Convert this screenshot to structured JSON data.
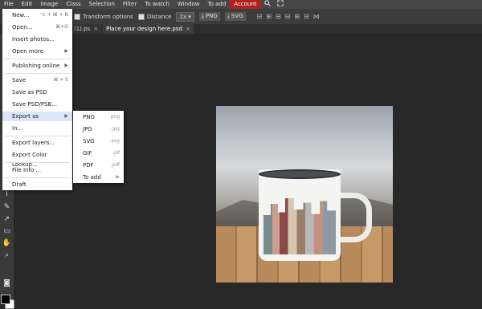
{
  "menubar": {
    "items": [
      "File",
      "Edit",
      "Image",
      "Class",
      "Selection",
      "Filter",
      "To watch",
      "Window",
      "To add",
      "Account"
    ],
    "icons": [
      "search-icon",
      "fullscreen-icon"
    ]
  },
  "optbar": {
    "transform_label": "Transform options",
    "distance_label": "Distance",
    "scale_value": "1x",
    "png_label": "PNG",
    "svg_label": "SVG"
  },
  "tabs": [
    {
      "label": "(1).ps",
      "close": "×"
    },
    {
      "label": "Place your design here.psd",
      "close": "×"
    }
  ],
  "file_menu": {
    "items": [
      {
        "label": "New...",
        "shortcut": "⌥ + ⌘ + N"
      },
      {
        "label": "Open...",
        "shortcut": "⌘+O"
      },
      {
        "label": "Insert photos...",
        "shortcut": ""
      },
      {
        "label": "Open more",
        "shortcut": "▶"
      },
      {
        "label": "Publishing online",
        "shortcut": "▶"
      },
      {
        "label": "Save",
        "shortcut": "⌘ + S"
      },
      {
        "label": "Save as PSD",
        "shortcut": ""
      },
      {
        "label": "Save PSD/PSB...",
        "shortcut": ""
      },
      {
        "label": "Export as",
        "shortcut": "▶"
      },
      {
        "label": "In...",
        "shortcut": ""
      },
      {
        "label": "Export layers...",
        "shortcut": ""
      },
      {
        "label": "Export Color Lookup...",
        "shortcut": ""
      },
      {
        "label": "File Info ...",
        "shortcut": ""
      },
      {
        "label": "Draft",
        "shortcut": ""
      }
    ]
  },
  "export_submenu": {
    "items": [
      {
        "label": "PNG",
        "ext": ".png"
      },
      {
        "label": "JPG",
        "ext": ".jpg"
      },
      {
        "label": "SVG",
        "ext": ".svg"
      },
      {
        "label": "GIF",
        "ext": ".gif"
      },
      {
        "label": "PDF",
        "ext": ".pdf"
      },
      {
        "label": "To add",
        "ext": "▶"
      }
    ]
  },
  "colors": {
    "accent": "#b32020",
    "highlight": "#d9e6f7",
    "background": "#282828"
  }
}
